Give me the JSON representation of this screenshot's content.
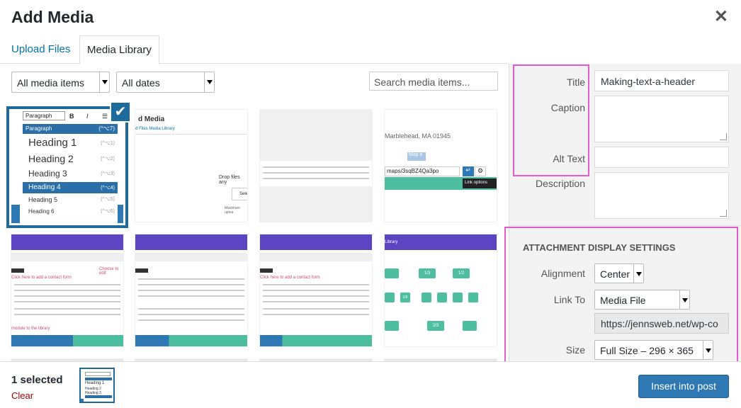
{
  "header": {
    "title": "Add Media",
    "close_icon": "close-icon"
  },
  "tabs": [
    {
      "label": "Upload Files"
    },
    {
      "label": "Media Library"
    }
  ],
  "filters": {
    "type_value": "All media items",
    "date_value": "All dates",
    "search_placeholder": "Search media items..."
  },
  "thumbs": {
    "heading_menu": [
      "Paragraph",
      "Heading 1",
      "Heading 2",
      "Heading 3",
      "Heading 4",
      "Heading 5",
      "Heading 6"
    ],
    "heading_shortcuts": [
      "(^⌥7)",
      "(^⌥1)",
      "(^⌥2)",
      "(^⌥3)",
      "(^⌥4)",
      "(^⌥5)",
      "(^⌥6)"
    ],
    "toolbar_paragraph": "Paragraph",
    "thumb2_title": "d Media",
    "thumb2_tabs": "d Files   Media Library",
    "thumb2_drop": "Drop files any",
    "thumb2_select": "Sele",
    "thumb2_max": "Maximum uploa",
    "thumb4_address": "Marblehead, MA 01945",
    "thumb4_map": "Map it",
    "thumb4_url": "maps/3sqBZ4Qa3po",
    "thumb4_tooltip": "Link options",
    "library_label": "Library",
    "choose": "Choose to edit",
    "click_here": "Click here to add a contact form",
    "module": "module to the library",
    "grid_labels": [
      "1/3",
      "1/2",
      "1/5"
    ],
    "grid_labels_bottom": [
      "2/3"
    ]
  },
  "sidebar": {
    "title_label": "Title",
    "title_value": "Making-text-a-header",
    "caption_label": "Caption",
    "alt_label": "Alt Text",
    "description_label": "Description",
    "section_heading": "ATTACHMENT DISPLAY SETTINGS",
    "alignment_label": "Alignment",
    "alignment_value": "Center",
    "link_label": "Link To",
    "link_value": "Media File",
    "url_value": "https://jennsweb.net/wp-co",
    "size_label": "Size",
    "size_value": "Full Size – 296 × 365"
  },
  "footer": {
    "selected_count": "1 selected",
    "clear_label": "Clear",
    "insert_label": "Insert into post"
  },
  "colors": {
    "accent": "#0073aa",
    "selected_border": "#1e6a9c",
    "highlight": "#e25cd0",
    "button": "#2e78b4"
  }
}
